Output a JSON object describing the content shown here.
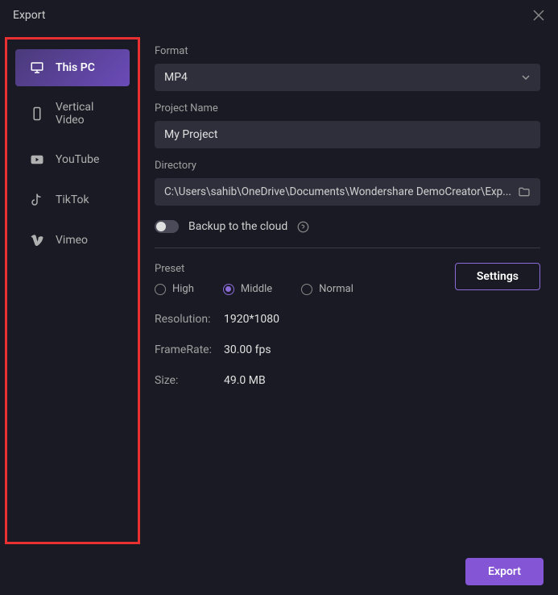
{
  "titlebar": {
    "title": "Export"
  },
  "sidebar": {
    "items": [
      {
        "label": "This PC"
      },
      {
        "label": "Vertical Video"
      },
      {
        "label": "YouTube"
      },
      {
        "label": "TikTok"
      },
      {
        "label": "Vimeo"
      }
    ]
  },
  "form": {
    "format_label": "Format",
    "format_value": "MP4",
    "project_name_label": "Project Name",
    "project_name_value": "My Project",
    "directory_label": "Directory",
    "directory_value": "C:\\Users\\sahib\\OneDrive\\Documents\\Wondershare DemoCreator\\Exp...",
    "backup_label": "Backup to the cloud"
  },
  "preset": {
    "label": "Preset",
    "options": [
      {
        "label": "High"
      },
      {
        "label": "Middle"
      },
      {
        "label": "Normal"
      }
    ],
    "selected": "Middle",
    "settings_button": "Settings"
  },
  "info": {
    "resolution_label": "Resolution:",
    "resolution_value": "1920*1080",
    "framerate_label": "FrameRate:",
    "framerate_value": "30.00 fps",
    "size_label": "Size:",
    "size_value": "49.0 MB"
  },
  "footer": {
    "export_button": "Export"
  }
}
